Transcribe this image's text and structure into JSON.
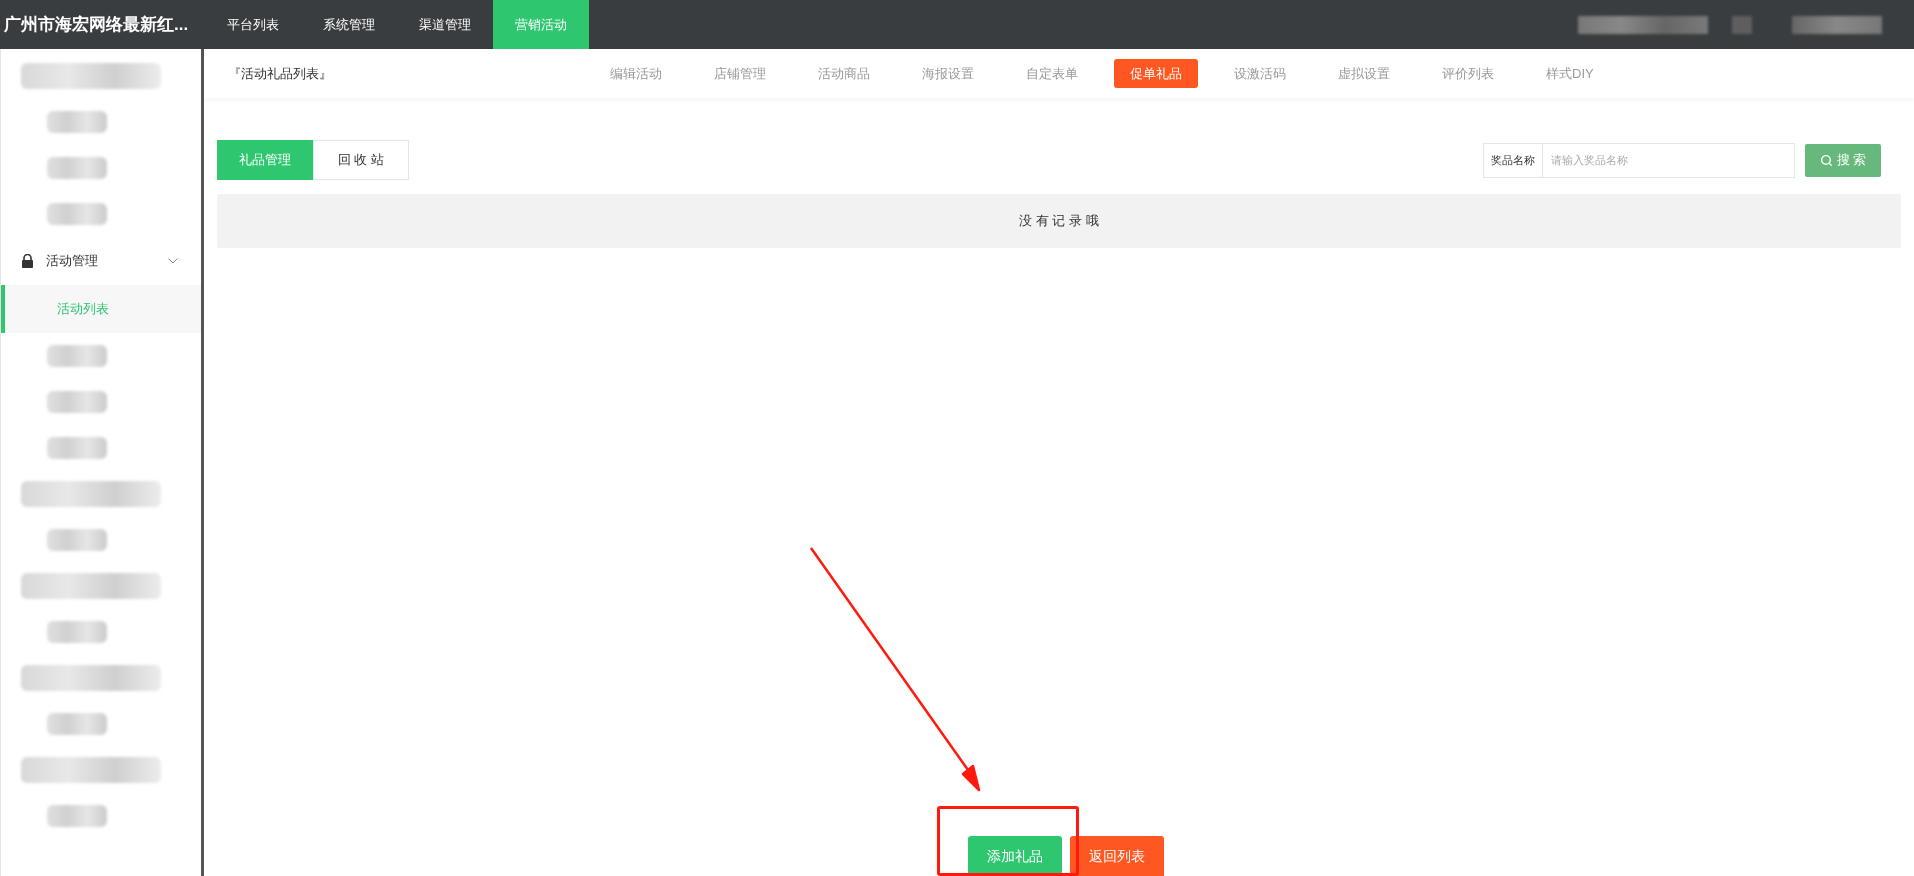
{
  "top_bar": {
    "title": "广州市海宏网络最新红...",
    "nav": [
      {
        "label": "平台列表",
        "selected": false
      },
      {
        "label": "系统管理",
        "selected": false
      },
      {
        "label": "渠道管理",
        "selected": false
      },
      {
        "label": "营销活动",
        "selected": true
      }
    ]
  },
  "sidebar": {
    "items": [
      {
        "kind": "blurred_group"
      },
      {
        "kind": "blurred_item"
      },
      {
        "kind": "blurred_item"
      },
      {
        "kind": "blurred_item"
      },
      {
        "kind": "group",
        "label": "活动管理",
        "expanded": true
      },
      {
        "kind": "item",
        "label": "活动列表",
        "selected": true
      },
      {
        "kind": "blurred_item"
      },
      {
        "kind": "blurred_item"
      },
      {
        "kind": "blurred_item"
      },
      {
        "kind": "blurred_group"
      },
      {
        "kind": "blurred_item"
      },
      {
        "kind": "blurred_group"
      },
      {
        "kind": "blurred_item"
      },
      {
        "kind": "blurred_group"
      },
      {
        "kind": "blurred_item"
      },
      {
        "kind": "blurred_group"
      },
      {
        "kind": "blurred_item"
      }
    ]
  },
  "sub_header": {
    "breadcrumb": "『活动礼品列表』",
    "tabs": [
      {
        "label": "编辑活动",
        "selected": false
      },
      {
        "label": "店铺管理",
        "selected": false
      },
      {
        "label": "活动商品",
        "selected": false
      },
      {
        "label": "海报设置",
        "selected": false
      },
      {
        "label": "自定表单",
        "selected": false
      },
      {
        "label": "促单礼品",
        "selected": true
      },
      {
        "label": "设激活码",
        "selected": false
      },
      {
        "label": "虚拟设置",
        "selected": false
      },
      {
        "label": "评价列表",
        "selected": false
      },
      {
        "label": "样式DIY",
        "selected": false
      }
    ]
  },
  "toggle": [
    {
      "label": "礼品管理",
      "selected": true
    },
    {
      "label": "回 收 站",
      "selected": false
    }
  ],
  "search": {
    "label": "奖品名称",
    "placeholder": "请输入奖品名称",
    "button": "搜 索"
  },
  "empty_message": "没 有 记 录 哦",
  "actions": [
    {
      "label": "添加礼品",
      "kind": "primary"
    },
    {
      "label": "返回列表",
      "kind": "danger"
    }
  ]
}
